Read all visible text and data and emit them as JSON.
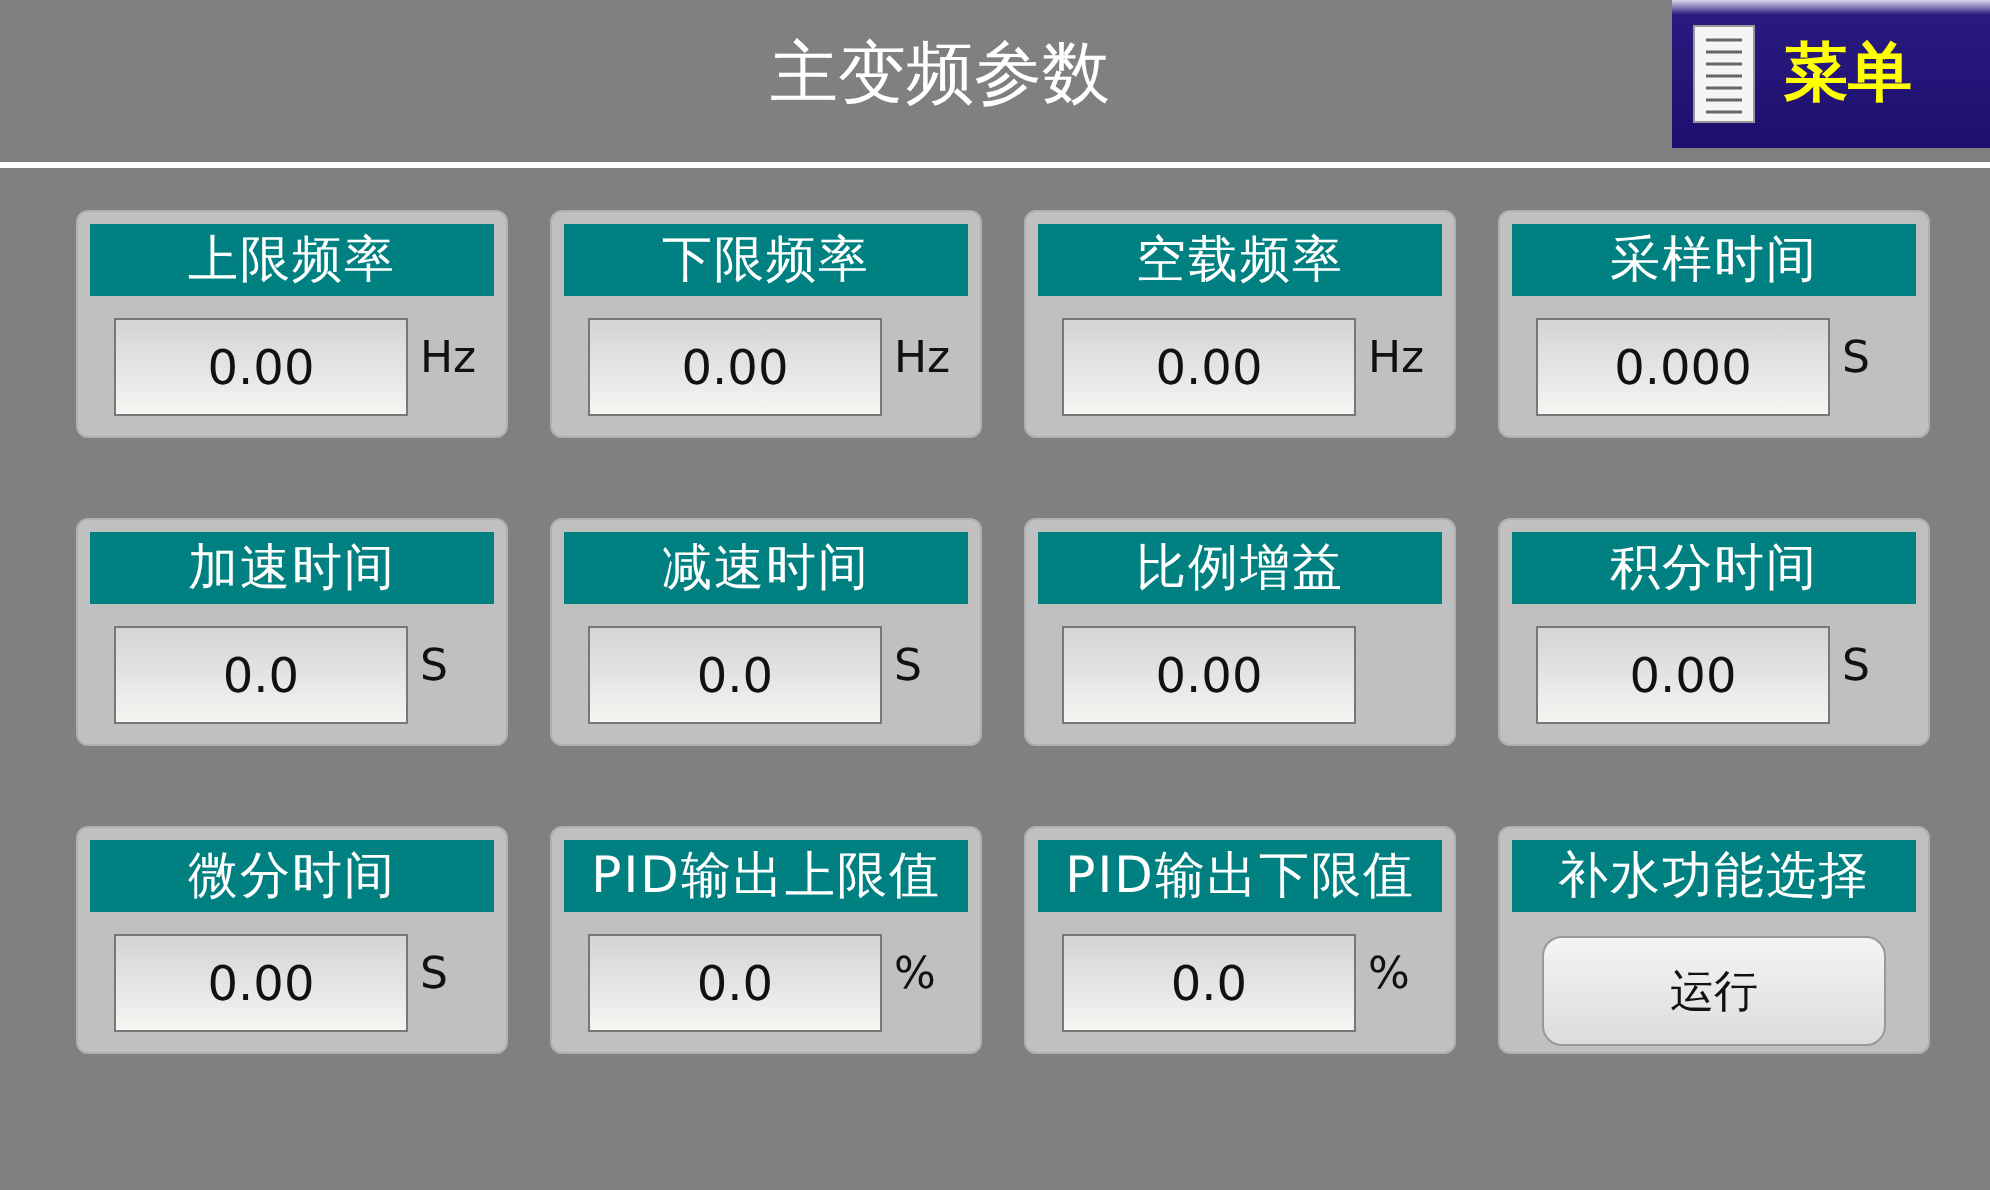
{
  "header": {
    "title": "主变频参数",
    "menu_button": "菜单"
  },
  "cards": [
    {
      "kind": "field",
      "title": "上限频率",
      "value": "0.00",
      "unit": "Hz"
    },
    {
      "kind": "field",
      "title": "下限频率",
      "value": "0.00",
      "unit": "Hz"
    },
    {
      "kind": "field",
      "title": "空载频率",
      "value": "0.00",
      "unit": "Hz"
    },
    {
      "kind": "field",
      "title": "采样时间",
      "value": "0.000",
      "unit": "S"
    },
    {
      "kind": "field",
      "title": "加速时间",
      "value": "0.0",
      "unit": "S"
    },
    {
      "kind": "field",
      "title": "减速时间",
      "value": "0.0",
      "unit": "S"
    },
    {
      "kind": "field",
      "title": "比例增益",
      "value": "0.00"
    },
    {
      "kind": "field",
      "title": "积分时间",
      "value": "0.00",
      "unit": "S"
    },
    {
      "kind": "field",
      "title": "微分时间",
      "value": "0.00",
      "unit": "S"
    },
    {
      "kind": "field",
      "title": "PID输出上限值",
      "value": "0.0",
      "unit": "%"
    },
    {
      "kind": "field",
      "title": "PID输出下限值",
      "value": "0.0",
      "unit": "%"
    },
    {
      "kind": "button",
      "title": "补水功能选择",
      "button": "运行"
    }
  ]
}
